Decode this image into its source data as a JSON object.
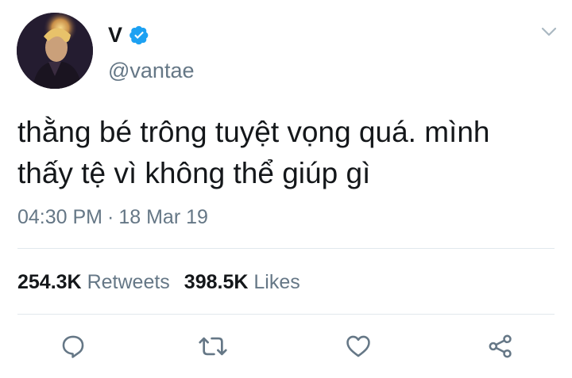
{
  "tweet": {
    "display_name": "V",
    "handle": "@vantae",
    "text_lines": [
      "thằng bé trông tuyệt vọng quá. mình",
      "thấy tệ vì không thể giúp gì"
    ],
    "time": "04:30 PM",
    "separator": "·",
    "date": "18 Mar 19",
    "retweets_count": "254.3K",
    "retweets_label": "Retweets",
    "likes_count": "398.5K",
    "likes_label": "Likes"
  },
  "icons": {
    "verified": "verified-badge-icon",
    "menu": "chevron-down-icon",
    "reply": "reply-icon",
    "retweet": "retweet-icon",
    "like": "heart-icon",
    "share": "share-icon"
  },
  "colors": {
    "text_primary": "#14171a",
    "text_secondary": "#657786",
    "verified_blue": "#1da1f2",
    "divider": "#e1e8ed",
    "action_icon": "#657786"
  }
}
